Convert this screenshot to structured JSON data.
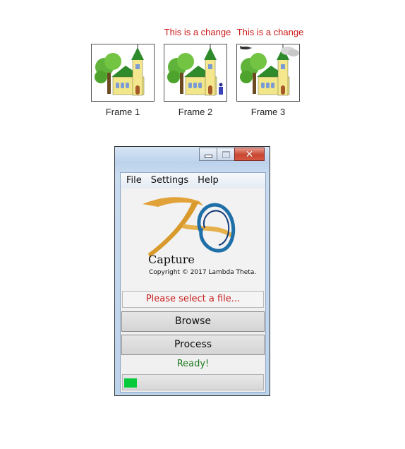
{
  "frames": [
    {
      "caption": "Frame 1",
      "note": ""
    },
    {
      "caption": "Frame 2",
      "note": "This is a change"
    },
    {
      "caption": "Frame 3",
      "note": "This is a change"
    }
  ],
  "window": {
    "menu": [
      "File",
      "Settings",
      "Help"
    ],
    "logo": {
      "title": "Capture",
      "copyright": "Copyright © 2017 Lambda Theta."
    },
    "status_text": "Please select a file...",
    "browse_label": "Browse",
    "process_label": "Process",
    "ready_text": "Ready!",
    "progress_fraction": 0.09
  },
  "colors": {
    "change_note": "#cc1a1a",
    "status_text": "#c81e1e",
    "ready_text": "#1e7a1e",
    "progress_fill": "#06c93b"
  }
}
